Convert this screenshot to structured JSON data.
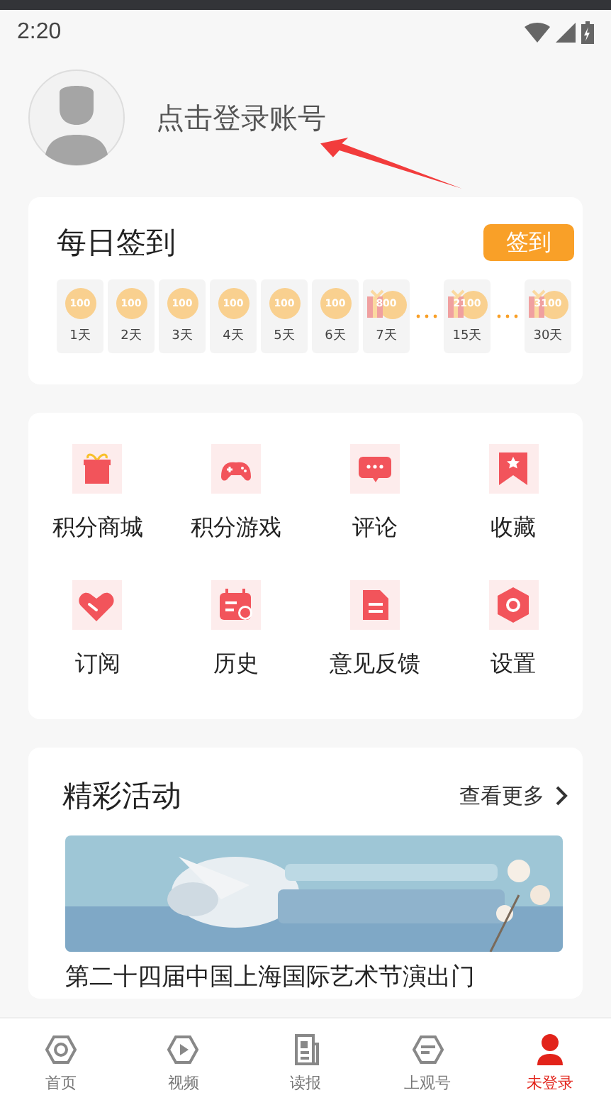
{
  "status_bar": {
    "time": "2:20"
  },
  "profile": {
    "login_prompt": "点击登录账号"
  },
  "checkin": {
    "title": "每日签到",
    "button": "签到",
    "days": [
      {
        "kind": "coin",
        "reward": "100",
        "day": "1天"
      },
      {
        "kind": "coin",
        "reward": "100",
        "day": "2天"
      },
      {
        "kind": "coin",
        "reward": "100",
        "day": "3天"
      },
      {
        "kind": "coin",
        "reward": "100",
        "day": "4天"
      },
      {
        "kind": "coin",
        "reward": "100",
        "day": "5天"
      },
      {
        "kind": "coin",
        "reward": "100",
        "day": "6天"
      },
      {
        "kind": "gift",
        "reward": "800",
        "day": "7天"
      },
      {
        "kind": "gap"
      },
      {
        "kind": "gift",
        "reward": "2100",
        "day": "15天"
      },
      {
        "kind": "gap"
      },
      {
        "kind": "gift",
        "reward": "3100",
        "day": "30天"
      }
    ]
  },
  "features": [
    {
      "kind": "gift",
      "label": "积分商城"
    },
    {
      "kind": "gamepad",
      "label": "积分游戏"
    },
    {
      "kind": "comment",
      "label": "评论"
    },
    {
      "kind": "bookmark",
      "label": "收藏"
    },
    {
      "kind": "heart",
      "label": "订阅"
    },
    {
      "kind": "calendar",
      "label": "历史"
    },
    {
      "kind": "document",
      "label": "意见反馈"
    },
    {
      "kind": "hexagon",
      "label": "设置"
    }
  ],
  "activities": {
    "title": "精彩活动",
    "more": "查看更多",
    "items": [
      {
        "kind": "picture",
        "title": "第二十四届中国上海国际艺术节演出门"
      }
    ]
  },
  "bottom_nav": [
    {
      "kind": "home",
      "label": "首页",
      "selected": false
    },
    {
      "kind": "video",
      "label": "视频",
      "selected": false
    },
    {
      "kind": "paper",
      "label": "读报",
      "selected": false
    },
    {
      "kind": "channel",
      "label": "上观号",
      "selected": false
    },
    {
      "kind": "user",
      "label": "未登录",
      "selected": true
    }
  ]
}
